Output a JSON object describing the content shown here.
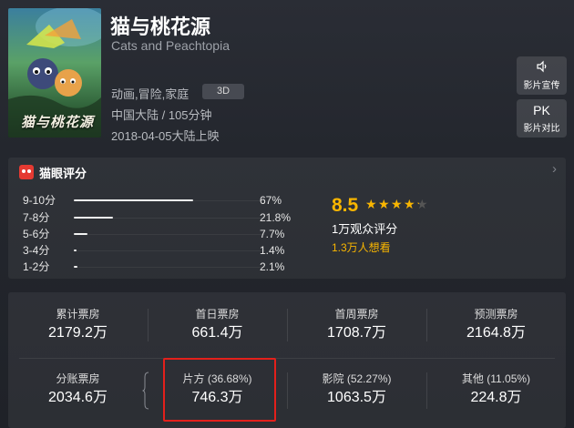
{
  "movie": {
    "title": "猫与桃花源",
    "english_title": "Cats and Peachtopia",
    "genres": "动画,冒险,家庭",
    "format_badge": "3D",
    "region_duration": "中国大陆 / 105分钟",
    "release": "2018-04-05大陆上映",
    "poster_text": "猫与桃花源"
  },
  "actions": {
    "promo_label": "影片宣传",
    "promo_icon": "speaker-icon",
    "pk_icon_text": "PK",
    "pk_label": "影片对比"
  },
  "rating": {
    "header": "猫眼评分",
    "score": "8.5",
    "stars_value": 4.25,
    "stars_max": 5,
    "votes": "1万观众评分",
    "want_to_see": "1.3万人想看",
    "distribution": [
      {
        "label": "9-10分",
        "percent": "67%",
        "value": 67
      },
      {
        "label": "7-8分",
        "percent": "21.8%",
        "value": 21.8
      },
      {
        "label": "5-6分",
        "percent": "7.7%",
        "value": 7.7
      },
      {
        "label": "3-4分",
        "percent": "1.4%",
        "value": 1.4
      },
      {
        "label": "1-2分",
        "percent": "2.1%",
        "value": 2.1
      }
    ]
  },
  "box_office": {
    "row1": [
      {
        "label": "累计票房",
        "value": "2179.2万"
      },
      {
        "label": "首日票房",
        "value": "661.4万"
      },
      {
        "label": "首周票房",
        "value": "1708.7万"
      },
      {
        "label": "预测票房",
        "value": "2164.8万"
      }
    ],
    "row2": [
      {
        "label": "分账票房",
        "value": "2034.6万"
      },
      {
        "label": "片方 (36.68%)",
        "value": "746.3万"
      },
      {
        "label": "影院 (52.27%)",
        "value": "1063.5万"
      },
      {
        "label": "其他 (11.05%)",
        "value": "224.8万"
      }
    ]
  },
  "colors": {
    "accent_gold": "#f8b500",
    "highlight_red": "#e3201b",
    "logo_red": "#e53a32"
  }
}
